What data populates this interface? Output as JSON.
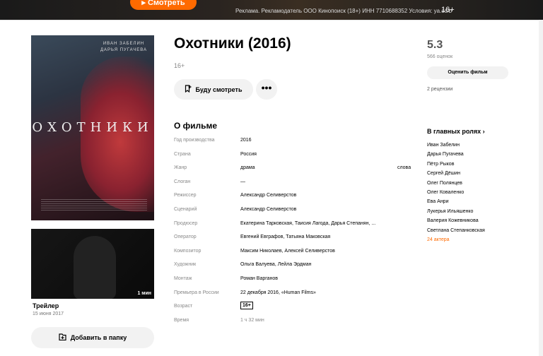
{
  "ad": {
    "button_label": "▸ Смотреть",
    "text": "Реклама. Рекламодатель ООО Кинопоиск (18+) ИНН 7710688352 Условия: ya.cc/b",
    "age": "16+"
  },
  "poster": {
    "names_line1": "ИВАН ЗАБЕЛИН",
    "names_line2": "ДАРЬЯ ПУГАЧЕВА",
    "title": "ОХОТНИКИ",
    "logo": "HUMAN"
  },
  "trailer": {
    "title": "Трейлер",
    "date": "15 июня 2017",
    "duration": "1 мин"
  },
  "folder_button": "Добавить в папку",
  "movie": {
    "title": "Охотники (2016)",
    "age": "16+",
    "watch_label": "Буду смотреть",
    "more_label": "•••",
    "about_title": "О фильме"
  },
  "facts": [
    {
      "label": "Год производства",
      "value": "2016"
    },
    {
      "label": "Страна",
      "value": "Россия"
    },
    {
      "label": "Жанр",
      "value": "драма",
      "extra": "слова"
    },
    {
      "label": "Слоган",
      "value": "—"
    },
    {
      "label": "Режиссер",
      "value": "Александр Селиверстов"
    },
    {
      "label": "Сценарий",
      "value": "Александр Селиверстов"
    },
    {
      "label": "Продюсер",
      "value": "Екатерина Тарковская, Таисия Лагода, Дарья Степанян, ..."
    },
    {
      "label": "Оператор",
      "value": "Евгений Евграфов, Татьяна Маковская"
    },
    {
      "label": "Композитор",
      "value": "Максим Николаев, Алексей Селиверстов"
    },
    {
      "label": "Художник",
      "value": "Ольга Валуева, Лейла Эрдман"
    },
    {
      "label": "Монтаж",
      "value": "Роман Варганов"
    },
    {
      "label": "Премьера в России",
      "value": "22 декабря 2016, «Human Films»"
    },
    {
      "label": "Возраст",
      "value": "16+"
    },
    {
      "label": "Время",
      "value": "1 ч 32 мин"
    }
  ],
  "rating": {
    "score": "5.3",
    "votes": "566 оценок",
    "rate_label": "Оценить фильм",
    "reviews": "2 рецензии"
  },
  "cast": {
    "title": "В главных ролях ›",
    "actors": [
      "Иван Забелин",
      "Дарья Пугачева",
      "Пётр Рыков",
      "Сергей Дёшин",
      "Олег Полянцев",
      "Олег Коваленко",
      "Ева Анри",
      "Лукерья Ильяшенко",
      "Валерия Кожевникова",
      "Светлана Степанковская"
    ],
    "more": "24 актера"
  },
  "colors": {
    "accent": "#ff6a00",
    "button_bg": "#f2f2f2",
    "muted": "#888888"
  }
}
